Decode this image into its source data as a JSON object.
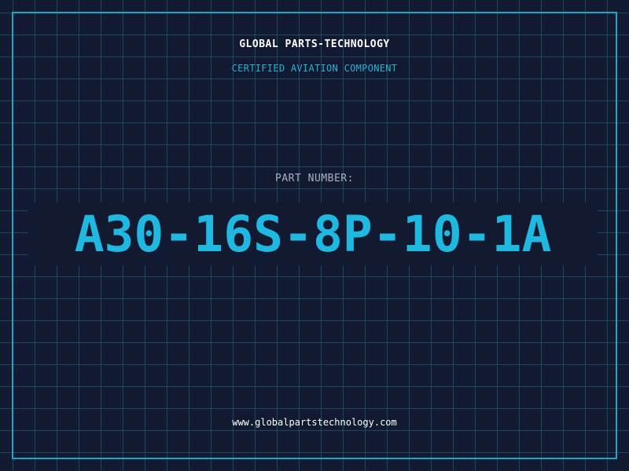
{
  "company": "GLOBAL PARTS-TECHNOLOGY",
  "subtitle": "CERTIFIED AVIATION COMPONENT",
  "part_label": "PART NUMBER:",
  "part_number": "A30-16S-8P-10-1A",
  "website": "www.globalpartstechnology.com",
  "colors": {
    "background": "#111a30",
    "grid": "#1c6e80",
    "accent": "#1fb8e0",
    "label": "#a7b1c4",
    "text": "#ffffff"
  }
}
